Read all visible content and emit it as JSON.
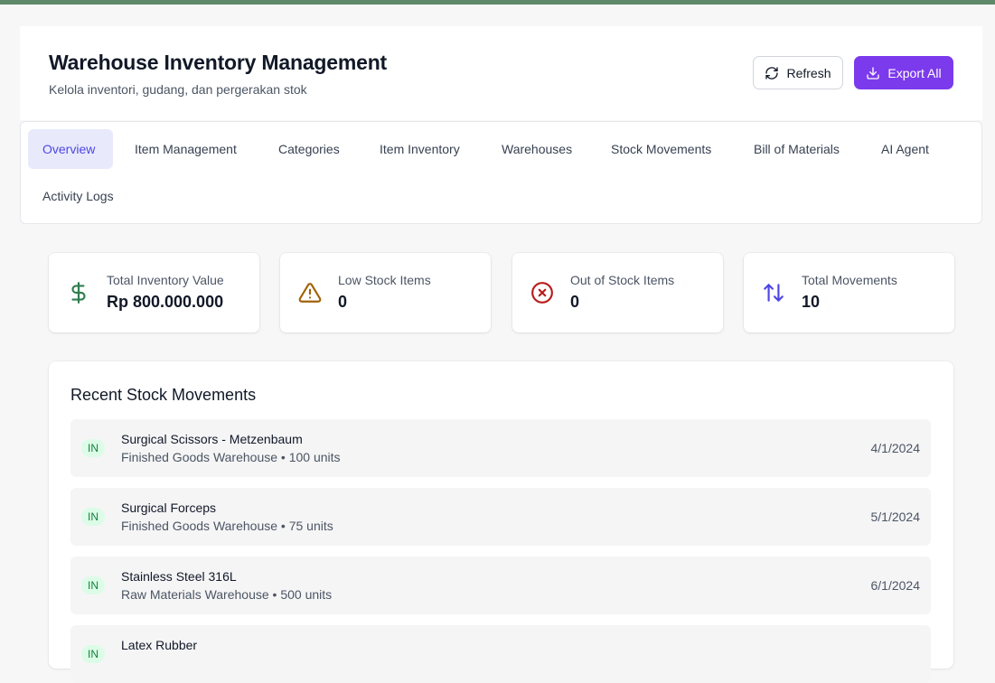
{
  "header": {
    "title": "Warehouse Inventory Management",
    "subtitle": "Kelola inventori, gudang, dan pergerakan stok",
    "refresh_label": "Refresh",
    "export_label": "Export All"
  },
  "tabs": [
    {
      "label": "Overview",
      "active": true
    },
    {
      "label": "Item Management"
    },
    {
      "label": "Categories"
    },
    {
      "label": "Item Inventory"
    },
    {
      "label": "Warehouses"
    },
    {
      "label": "Stock Movements"
    },
    {
      "label": "Bill of Materials"
    },
    {
      "label": "AI Agent"
    },
    {
      "label": "Activity Logs"
    }
  ],
  "stats": [
    {
      "label": "Total Inventory Value",
      "value": "Rp 800.000.000",
      "icon": "dollar-icon",
      "color": "#2f7d4f"
    },
    {
      "label": "Low Stock Items",
      "value": "0",
      "icon": "warning-icon",
      "color": "#a16207"
    },
    {
      "label": "Out of Stock Items",
      "value": "0",
      "icon": "x-circle-icon",
      "color": "#b91c1c"
    },
    {
      "label": "Total Movements",
      "value": "10",
      "icon": "arrows-updown-icon",
      "color": "#4f46e5"
    }
  ],
  "recent": {
    "title": "Recent Stock Movements",
    "items": [
      {
        "type": "IN",
        "name": "Surgical Scissors - Metzenbaum",
        "meta": "Finished Goods Warehouse • 100 units",
        "date": "4/1/2024"
      },
      {
        "type": "IN",
        "name": "Surgical Forceps",
        "meta": "Finished Goods Warehouse • 75 units",
        "date": "5/1/2024"
      },
      {
        "type": "IN",
        "name": "Stainless Steel 316L",
        "meta": "Raw Materials Warehouse • 500 units",
        "date": "6/1/2024"
      },
      {
        "type": "IN",
        "name": "Latex Rubber",
        "meta": "",
        "date": ""
      }
    ]
  },
  "colors": {
    "accent": "#7c3aed",
    "tab_active_bg": "#e8eafb",
    "tab_active_text": "#4f46e5",
    "badge_in_bg": "#dcfce7",
    "badge_in_text": "#15803d"
  }
}
